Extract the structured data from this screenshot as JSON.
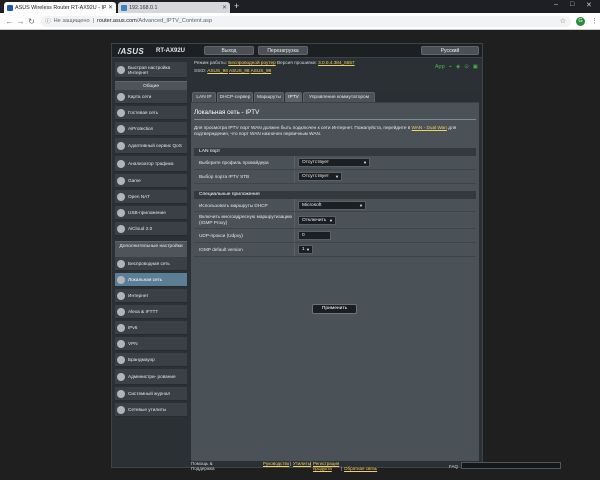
{
  "browser": {
    "tab1_title": "ASUS Wireless Router RT-AX92U - IPTV",
    "tab2_title": "192.168.0.1",
    "omni_warning": "Не защищено",
    "omni_host": "router.asus.com",
    "omni_path": "/Advanced_IPTV_Content.asp",
    "avatar_letter": "G"
  },
  "router": {
    "logo": "/ASUS",
    "model": "RT-AX92U",
    "btn_logout": "Выход",
    "btn_reboot": "Перезагрузка",
    "language": "Русский",
    "status_row1_label": "Режим работы:",
    "status_row1_mode": "Беспроводной роутер",
    "status_row1_fw_label": "Версия прошивки:",
    "status_row1_fw": "3.0.0.4.384_6557",
    "status_row2_label": "SSID:",
    "status_ssid1": "ASUS_98",
    "status_ssid2": "ASUS_98",
    "status_ssid3": "ASUS_98",
    "status_app": "App"
  },
  "sidebar": {
    "quick_setup": "Быстрая настройка Интернет",
    "general_header": "Общие",
    "items": [
      "Карта сети",
      "Гостевая сеть",
      "AiProtection",
      "Адаптивный сервис QoS",
      "Анализатор трафика",
      "Game",
      "Open NAT",
      "USB-приложение",
      "AiCloud 2.0"
    ],
    "advanced_header": "Дополнительные настройки",
    "advanced_items": [
      "Беспроводная сеть",
      "Локальная сеть",
      "Интернет",
      "Alexa & IFTTT",
      "IPv6",
      "VPN",
      "Брандмауэр",
      "Администри- рование",
      "Системный журнал",
      "Сетевые утилиты"
    ]
  },
  "tabs": [
    "LAN IP",
    "DHCP-сервер",
    "Маршруты",
    "IPTV",
    "Управление коммутатором"
  ],
  "main": {
    "title": "Локальная сеть - IPTV",
    "desc_part1": "Для просмотра IPTV порт WAN должен быть подключен к сети Интернет. Пожалуйста, перейдите в",
    "desc_link": "WAN - Dual Wan",
    "desc_part2": "для подтверждения, что порт WAN назначен первичным WAN.",
    "sec1": "LAN порт",
    "row1_label": "Выберите профиль провайдера",
    "row1_value": "Отсутствует",
    "row2_label": "Выбор порта IPTV STB",
    "row2_value": "Отсутствует",
    "sec2": "Специальные приложения",
    "row3_label": "Использовать маршруты DHCP",
    "row3_value": "Microsoft",
    "row4_label": "Включить многоадресную маршрутизацию (IGMP Proxy)",
    "row4_value": "Отключить",
    "row5_label": "UDP-прокси (Udpxy)",
    "row5_value": "0",
    "row6_label": "IGMP default version",
    "row6_value": "1",
    "apply": "Применить"
  },
  "footer": {
    "help": "Помощь & Поддержка",
    "manual": "Руководство",
    "utility": "Утилиты",
    "register": "Регистрация продукта",
    "feedback": "Обратная связь",
    "faq": "FAQ"
  }
}
